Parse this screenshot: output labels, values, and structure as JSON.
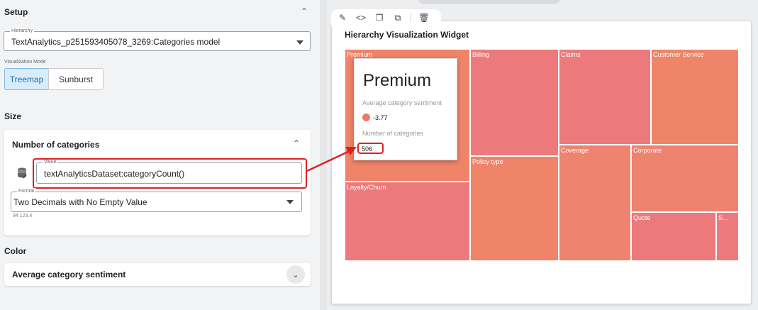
{
  "setup": {
    "title": "Setup",
    "hierarchy_label": "Hierarchy",
    "hierarchy_value": "TextAnalytics_p251593405078_3269:Categories model",
    "visualization_mode_label": "Visualization Mode",
    "modes": [
      "Treemap",
      "Sunburst"
    ],
    "active_mode": "Treemap"
  },
  "size": {
    "title": "Size",
    "card_title": "Number of categories",
    "value_label": "Value",
    "value": "textAnalyticsDataset:categoryCount()",
    "format_label": "Format",
    "format_value": "Two Decimals with No Empty Value",
    "format_hint": "94 123.4"
  },
  "color": {
    "title": "Color",
    "card_title": "Average category sentiment"
  },
  "widget": {
    "title": "Hierarchy Visualization Widget",
    "toolbar_icons": [
      "edit-icon",
      "code-icon",
      "copy-icon",
      "duplicate-icon",
      "delete-icon"
    ],
    "tiles": [
      {
        "label": "Premium"
      },
      {
        "label": "Billing"
      },
      {
        "label": "Claims"
      },
      {
        "label": "Customer Service"
      },
      {
        "label": "Loyalty/Churn"
      },
      {
        "label": "Policy type"
      },
      {
        "label": "Coverage"
      },
      {
        "label": "Corporate"
      },
      {
        "label": "Quote"
      },
      {
        "label": "S..."
      }
    ]
  },
  "tooltip": {
    "title": "Premium",
    "sentiment_label": "Average category sentiment",
    "sentiment_value": "-3.77",
    "count_label": "Number of categories",
    "count_value": "506"
  },
  "colors": {
    "accent": "#1b6fb3",
    "highlight": "#e02020",
    "tile_orange": "#ef8469",
    "tile_pink": "#ec7a7c"
  }
}
